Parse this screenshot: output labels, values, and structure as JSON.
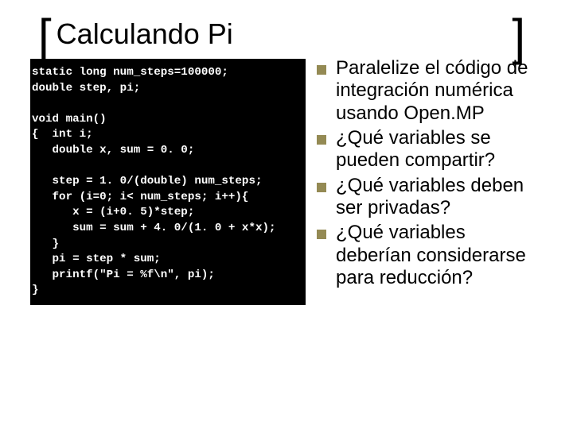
{
  "title": "Calculando Pi",
  "brackets": {
    "left": "[",
    "right": "]"
  },
  "code": "static long num_steps=100000;\ndouble step, pi;\n\nvoid main()\n{  int i;\n   double x, sum = 0. 0;\n\n   step = 1. 0/(double) num_steps;\n   for (i=0; i< num_steps; i++){\n      x = (i+0. 5)*step;\n      sum = sum + 4. 0/(1. 0 + x*x);\n   }\n   pi = step * sum;\n   printf(\"Pi = %f\\n\", pi);\n}",
  "bullets": [
    "Paralelize el código de integración numérica usando Open.MP",
    "¿Qué variables se pueden compartir?",
    "¿Qué variables deben ser privadas?",
    "¿Qué variables deberían considerarse para reducción?"
  ]
}
